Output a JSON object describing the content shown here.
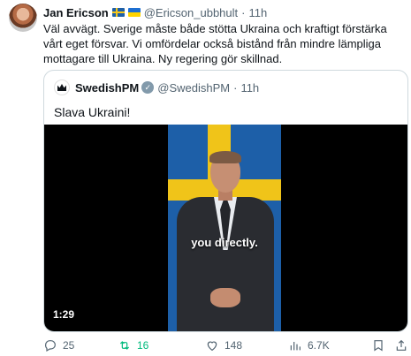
{
  "tweet": {
    "author_name": "Jan Ericson",
    "author_handle": "@Ericson_ubbhult",
    "separator": "·",
    "time": "11h",
    "text": "Väl avvägt. Sverige måste både stötta Ukraina och kraftigt förstärka vårt eget försvar. Vi omfördelar också bistånd från mindre lämpliga mottagare till Ukraina. Ny regering gör skillnad."
  },
  "quoted": {
    "author_name": "SwedishPM",
    "author_handle": "@SwedishPM",
    "separator": "·",
    "time": "11h",
    "text": "Slava Ukraini!",
    "video": {
      "caption": "you directly.",
      "duration": "1:29"
    }
  },
  "actions": {
    "replies": "25",
    "retweets": "16",
    "likes": "148",
    "views": "6.7K"
  },
  "colors": {
    "retweet_green": "#00ba7c",
    "muted_text": "#536471",
    "border": "#cfd9de"
  },
  "icons": [
    "reply-icon",
    "retweet-icon",
    "like-icon",
    "views-icon",
    "bookmark-icon",
    "share-icon",
    "verified-badge-icon",
    "sweden-flag-icon",
    "ukraine-flag-icon"
  ]
}
